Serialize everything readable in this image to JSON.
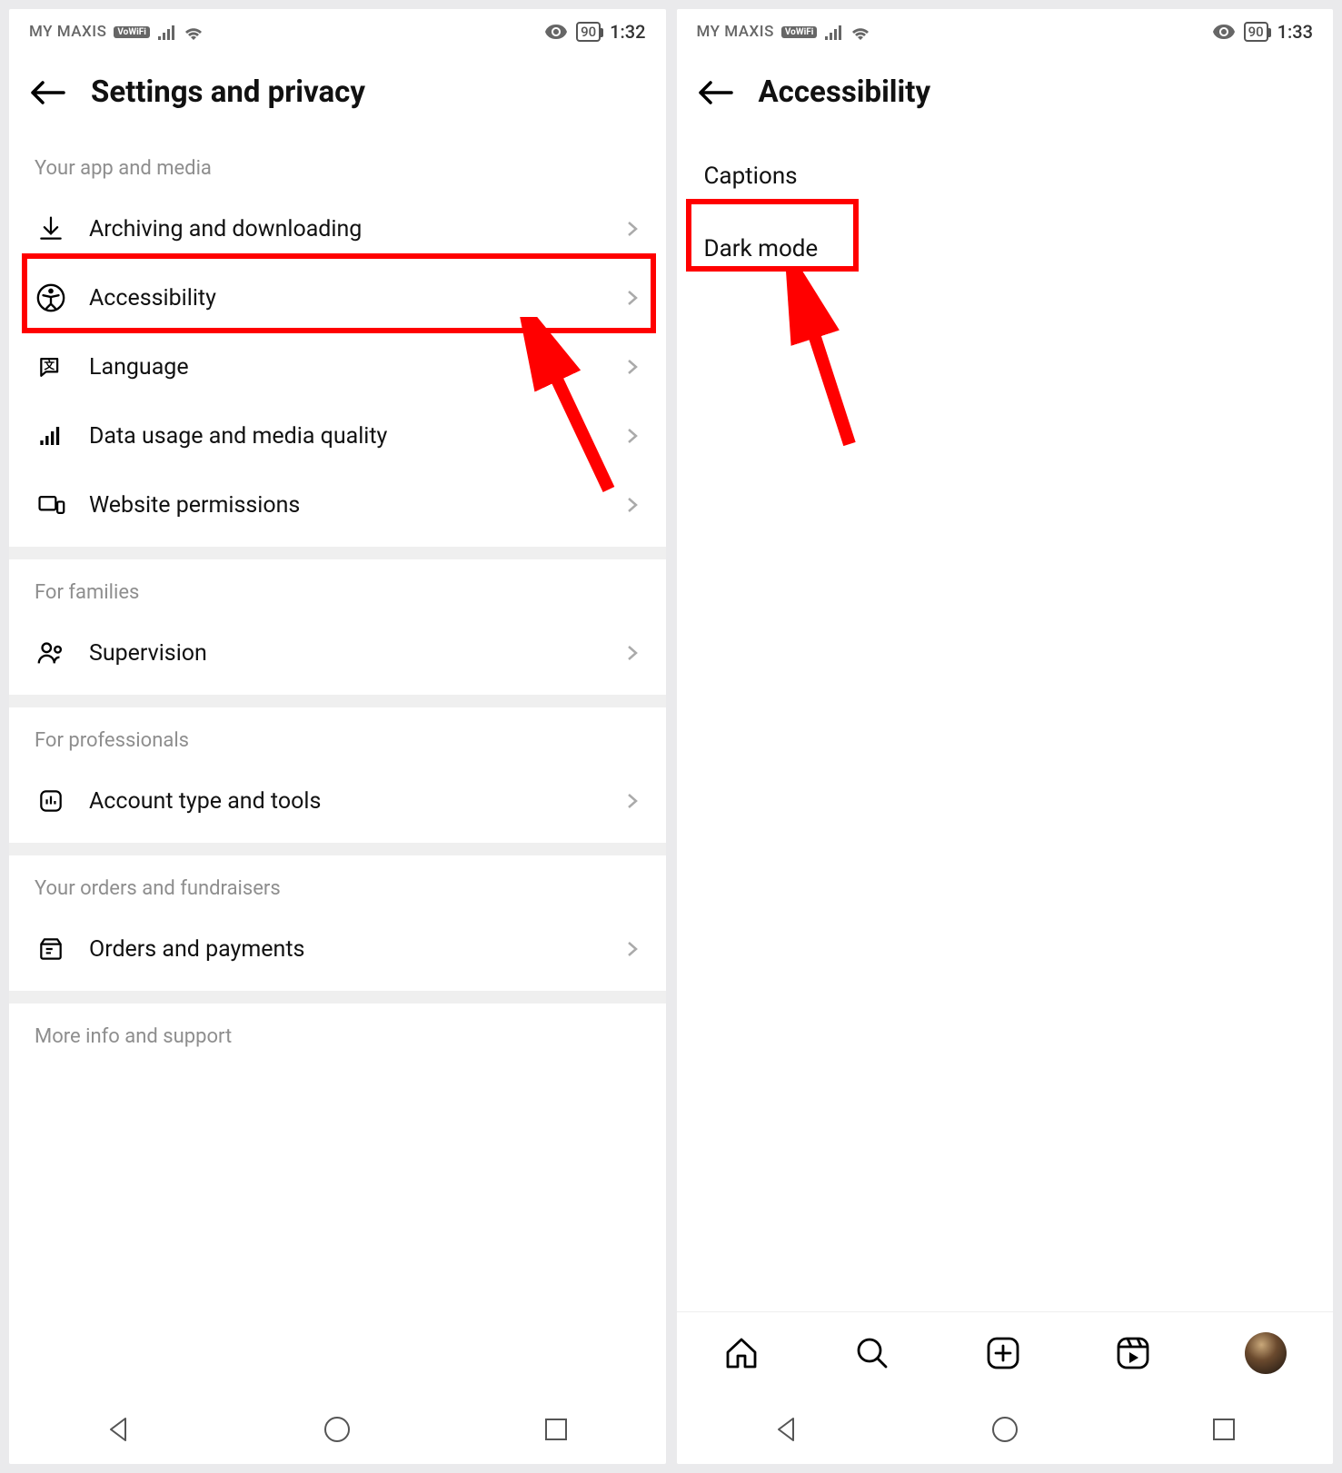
{
  "phone1": {
    "status": {
      "carrier": "MY MAXIS",
      "vowifi": "VoWiFi",
      "battery": "90",
      "time": "1:32"
    },
    "header": {
      "title": "Settings and privacy"
    },
    "sections": [
      {
        "heading": "Your app and media",
        "items": [
          {
            "icon": "download-icon",
            "label": "Archiving and downloading"
          },
          {
            "icon": "accessibility-icon",
            "label": "Accessibility",
            "highlighted": true
          },
          {
            "icon": "language-icon",
            "label": "Language"
          },
          {
            "icon": "data-icon",
            "label": "Data usage and media quality"
          },
          {
            "icon": "website-icon",
            "label": "Website permissions"
          }
        ]
      },
      {
        "heading": "For families",
        "items": [
          {
            "icon": "supervision-icon",
            "label": "Supervision"
          }
        ]
      },
      {
        "heading": "For professionals",
        "items": [
          {
            "icon": "account-tools-icon",
            "label": "Account type and tools"
          }
        ]
      },
      {
        "heading": "Your orders and fundraisers",
        "items": [
          {
            "icon": "orders-icon",
            "label": "Orders and payments"
          }
        ]
      },
      {
        "heading": "More info and support",
        "items": []
      }
    ]
  },
  "phone2": {
    "status": {
      "carrier": "MY MAXIS",
      "vowifi": "VoWiFi",
      "battery": "90",
      "time": "1:33"
    },
    "header": {
      "title": "Accessibility"
    },
    "items": [
      {
        "label": "Captions"
      },
      {
        "label": "Dark mode",
        "highlighted": true
      }
    ],
    "bottomnav": [
      {
        "name": "home-icon"
      },
      {
        "name": "search-icon"
      },
      {
        "name": "create-icon"
      },
      {
        "name": "reels-icon"
      },
      {
        "name": "profile-avatar"
      }
    ]
  },
  "annotations": {
    "highlight_color": "#ff0000"
  }
}
